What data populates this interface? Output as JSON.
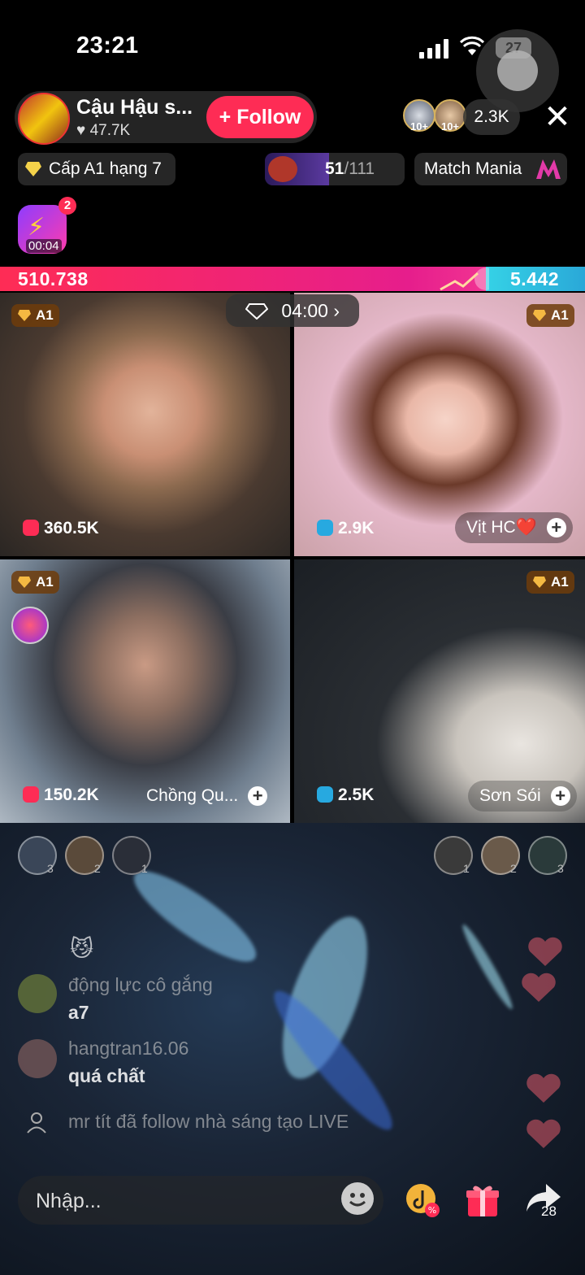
{
  "status_bar": {
    "time": "23:21",
    "battery": "27"
  },
  "host": {
    "name": "Cậu Hậu s...",
    "likes": "47.7K",
    "follow_label": "Follow"
  },
  "viewers": {
    "badge1": "10+",
    "badge2": "10+",
    "count": "2.3K"
  },
  "chips": {
    "level": "Cấp A1 hạng 7",
    "progress_current": "51",
    "progress_total": "/111",
    "progress_fraction": 0.46,
    "match": "Match Mania"
  },
  "boost": {
    "count": "2",
    "time": "00:04"
  },
  "battle": {
    "left_score": "510.738",
    "right_score": "5.442",
    "timer": "04:00"
  },
  "tiles": [
    {
      "rank": "A1",
      "score": "360.5K",
      "name": ""
    },
    {
      "rank": "A1",
      "score": "2.9K",
      "name": "Vịt HC❤️"
    },
    {
      "rank": "A1",
      "score": "150.2K",
      "name": "Chồng Qu..."
    },
    {
      "rank": "A1",
      "score": "2.5K",
      "name": "Sơn Sói"
    }
  ],
  "gifters_left": [
    "3",
    "2",
    "1"
  ],
  "gifters_right": [
    "1",
    "2",
    "3"
  ],
  "comments": [
    {
      "user": "động lực cô gắng",
      "text": "a7"
    },
    {
      "user": "hangtran16.06",
      "text": "quá chất"
    }
  ],
  "system_message": "mr tít đã follow nhà sáng tạo LIVE",
  "input": {
    "placeholder": "Nhập..."
  },
  "share_count": "28",
  "colors": {
    "accent": "#fe2c55",
    "battle_right": "#35d2e6"
  }
}
